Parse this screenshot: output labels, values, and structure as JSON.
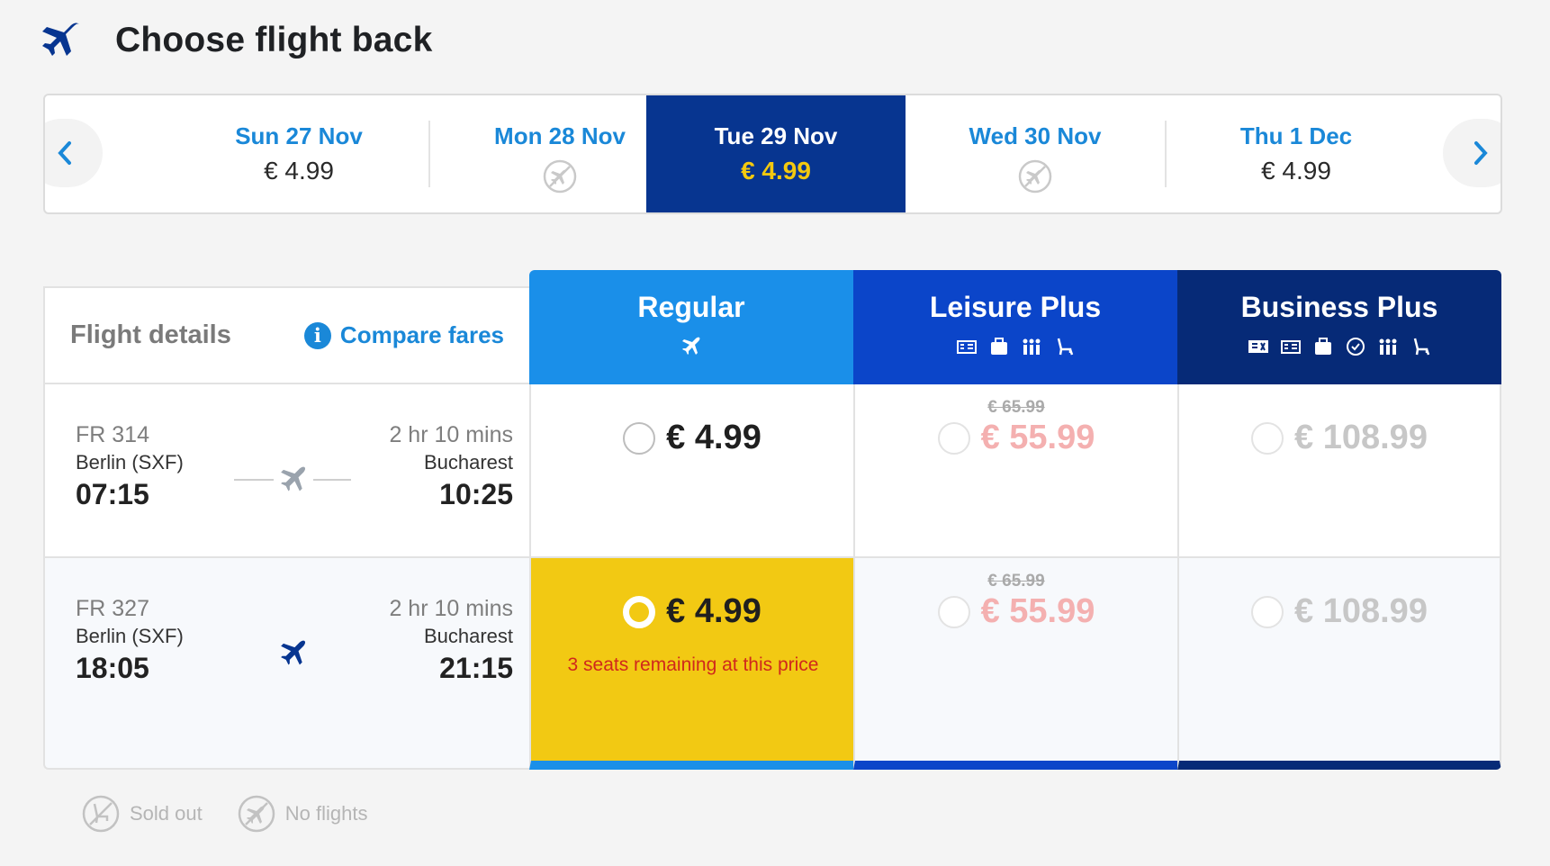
{
  "header": {
    "title": "Choose flight back",
    "icon": "plane-icon"
  },
  "dates": [
    {
      "label": "Sun 27 Nov",
      "price": "€ 4.99",
      "has_flights": true,
      "active": false
    },
    {
      "label": "Mon 28 Nov",
      "price": "",
      "has_flights": false,
      "active": false
    },
    {
      "label": "Tue 29 Nov",
      "price": "€ 4.99",
      "has_flights": true,
      "active": true
    },
    {
      "label": "Wed 30 Nov",
      "price": "",
      "has_flights": false,
      "active": false
    },
    {
      "label": "Thu 1 Dec",
      "price": "€ 4.99",
      "has_flights": true,
      "active": false
    }
  ],
  "table": {
    "details_label": "Flight details",
    "compare_label": "Compare fares",
    "fares": [
      {
        "name": "Regular",
        "color": "#1a8fe9",
        "icons": [
          "plane-icon"
        ]
      },
      {
        "name": "Leisure Plus",
        "color": "#0b45c9",
        "icons": [
          "seat-map-icon",
          "bag-icon",
          "queue-icon",
          "seat-icon"
        ]
      },
      {
        "name": "Business Plus",
        "color": "#062a77",
        "icons": [
          "flexible-ticket-icon",
          "seat-map-icon",
          "bag-icon",
          "fast-track-icon",
          "queue-icon",
          "seat-icon"
        ]
      }
    ],
    "flights": [
      {
        "number": "FR 314",
        "origin": "Berlin (SXF)",
        "depart": "07:15",
        "duration": "2 hr 10 mins",
        "destination": "Bucharest",
        "arrive": "10:25",
        "regular": {
          "price": "€ 4.99",
          "selected": false,
          "seats_note": ""
        },
        "leisure": {
          "old_price": "€ 65.99",
          "price": "€ 55.99"
        },
        "business": {
          "price": "€ 108.99"
        }
      },
      {
        "number": "FR 327",
        "origin": "Berlin (SXF)",
        "depart": "18:05",
        "duration": "2 hr 10 mins",
        "destination": "Bucharest",
        "arrive": "21:15",
        "regular": {
          "price": "€ 4.99",
          "selected": true,
          "seats_note": "3 seats remaining at this price"
        },
        "leisure": {
          "old_price": "€ 65.99",
          "price": "€ 55.99"
        },
        "business": {
          "price": "€ 108.99"
        }
      }
    ]
  },
  "legend": [
    {
      "label": "Sold out",
      "icon": "sold-out-icon"
    },
    {
      "label": "No flights",
      "icon": "no-flights-icon"
    }
  ],
  "colors": {
    "accent": "#1a88d8",
    "active_date_bg": "#073590",
    "active_price": "#f3c90f",
    "selected_fare": "#f2c913",
    "warning": "#d0281c"
  }
}
